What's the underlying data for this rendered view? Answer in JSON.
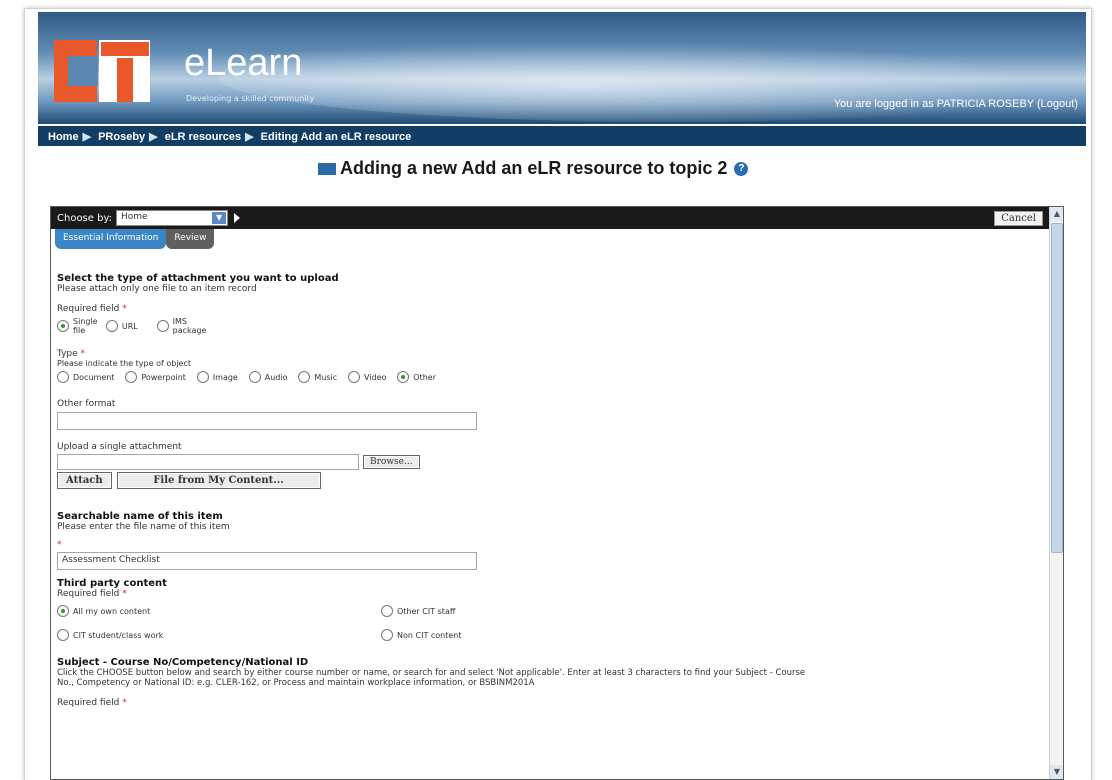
{
  "brand": {
    "name": "eLearn",
    "tagline": "Developing a skilled community"
  },
  "user": {
    "text": "You are logged in as PATRICIA ROSEBY",
    "logout": "(Logout)"
  },
  "breadcrumb": [
    "Home",
    "PRoseby",
    "eLR resources",
    "Editing Add an eLR resource"
  ],
  "breadcrumb_sep": "▶",
  "page_title": "Adding a new Add an eLR resource to topic 2",
  "toolbar": {
    "choose_label": "Choose by:",
    "choose_value": "Home",
    "cancel": "Cancel"
  },
  "tabs": [
    "Essential Information",
    "Review"
  ],
  "attachment": {
    "heading": "Select the type of attachment you want to upload",
    "hint": "Please attach only one file to an item record",
    "required": "Required field",
    "options": [
      "Single file",
      "URL",
      "IMS package"
    ],
    "selected": "Single file"
  },
  "type": {
    "label": "Type",
    "hint": "Please indicate the type of object",
    "options": [
      "Document",
      "Powerpoint",
      "Image",
      "Audio",
      "Music",
      "Video",
      "Other"
    ],
    "selected": "Other"
  },
  "other_format": {
    "label": "Other format",
    "value": ""
  },
  "upload": {
    "label": "Upload a single attachment",
    "browse": "Browse...",
    "attach": "Attach",
    "from_content": "File from My Content..."
  },
  "searchable": {
    "heading": "Searchable name of this item",
    "hint": "Please enter the file name of this item",
    "value": "Assessment Checklist"
  },
  "third_party": {
    "heading": "Third party content",
    "required": "Required field",
    "options": [
      "All my own content",
      "Other CIT staff",
      "CIT student/class work",
      "Non CIT content"
    ],
    "selected": "All my own content"
  },
  "subject": {
    "heading": "Subject - Course No/Competency/National ID",
    "hint1": "Click the CHOOSE button below and search by either course number or name, or search for and select 'Not applicable'. Enter at least 3 characters to find your Subject - Course",
    "hint2": "No., Competency or National ID: e.g. CLER-162, or Process and maintain workplace information, or BSBINM201A",
    "required": "Required field"
  },
  "colors": {
    "banner": "#3f6d98",
    "breadcrumb_bg": "#123e66",
    "logo_orange": "#e8582a",
    "tab_active": "#3b86c4"
  }
}
